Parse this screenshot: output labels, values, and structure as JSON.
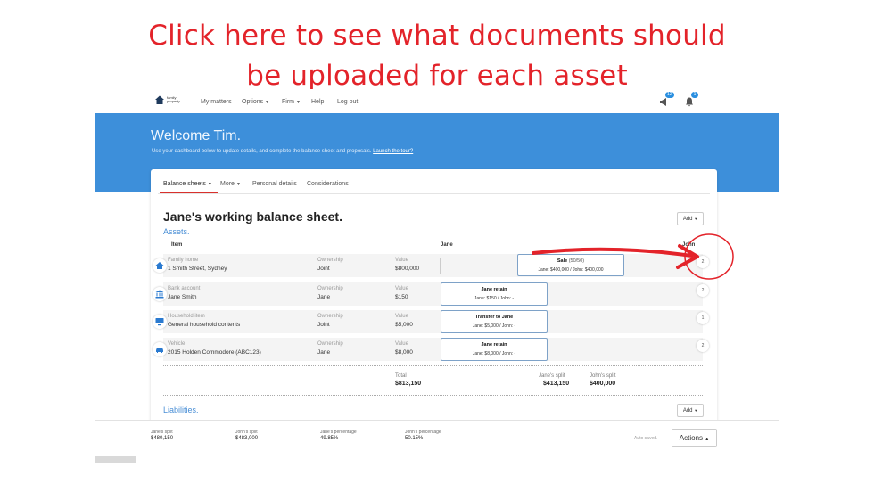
{
  "headline": {
    "line1": "Click here to see what documents should",
    "line2": "be uploaded for each asset"
  },
  "nav": {
    "logo_text_1": "family",
    "logo_text_2": "property",
    "links": [
      "My matters",
      "Options",
      "Firm",
      "Help",
      "Log out"
    ],
    "megaphone_badge": "12",
    "bell_badge": "1",
    "more": "..."
  },
  "hero": {
    "welcome": "Welcome Tim.",
    "subtitle": "Use your dashboard below to update details, and complete the balance sheet and proposals.",
    "tour_link": "Launch the tour?"
  },
  "tabs": [
    "Balance sheets",
    "More",
    "Personal details",
    "Considerations"
  ],
  "sheet": {
    "title": "Jane's working balance sheet.",
    "add_label": "Add",
    "assets_label": "Assets.",
    "liabilities_label": "Liabilities.",
    "col_item": "Item",
    "col_jane": "Jane",
    "col_john": "John",
    "ownership_label": "Ownership",
    "value_label": "Value",
    "rows": [
      {
        "category": "Family home",
        "name": "1 Smith Street, Sydney",
        "ownership": "Joint",
        "value": "$800,000",
        "popup_title": "Sale",
        "popup_sub": "(50/50)",
        "popup_detail": "Jane: $400,000 / John: $400,000",
        "count": "2"
      },
      {
        "category": "Bank account",
        "name": "Jane Smith",
        "ownership": "Jane",
        "value": "$150",
        "popup_title": "Jane retain",
        "popup_sub": "",
        "popup_detail": "Jane: $150 / John: -",
        "count": "2"
      },
      {
        "category": "Household item",
        "name": "General household contents",
        "ownership": "Joint",
        "value": "$5,000",
        "popup_title": "Transfer to Jane",
        "popup_sub": "",
        "popup_detail": "Jane: $5,000 / John: -",
        "count": "1"
      },
      {
        "category": "Vehicle",
        "name": "2015 Holden Commodore (ABC123)",
        "ownership": "Jane",
        "value": "$8,000",
        "popup_title": "Jane retain",
        "popup_sub": "",
        "popup_detail": "Jane: $8,000 / John: -",
        "count": "2"
      }
    ],
    "totals": {
      "total_label": "Total",
      "total_value": "$813,150",
      "jane_label": "Jane's split",
      "jane_value": "$413,150",
      "john_label": "John's split",
      "john_value": "$400,000"
    }
  },
  "footer": {
    "items": [
      {
        "label": "Jane's split",
        "value": "$480,150"
      },
      {
        "label": "John's split",
        "value": "$483,000"
      },
      {
        "label": "Jane's percentage",
        "value": "49.85%"
      },
      {
        "label": "John's percentage",
        "value": "50.15%"
      }
    ],
    "autosaved": "Auto saved.",
    "actions_label": "Actions"
  },
  "colors": {
    "headline": "#e3232a",
    "hero": "#3d8fda",
    "accent": "#2a8fe0",
    "tab_active": "#d9312d"
  }
}
